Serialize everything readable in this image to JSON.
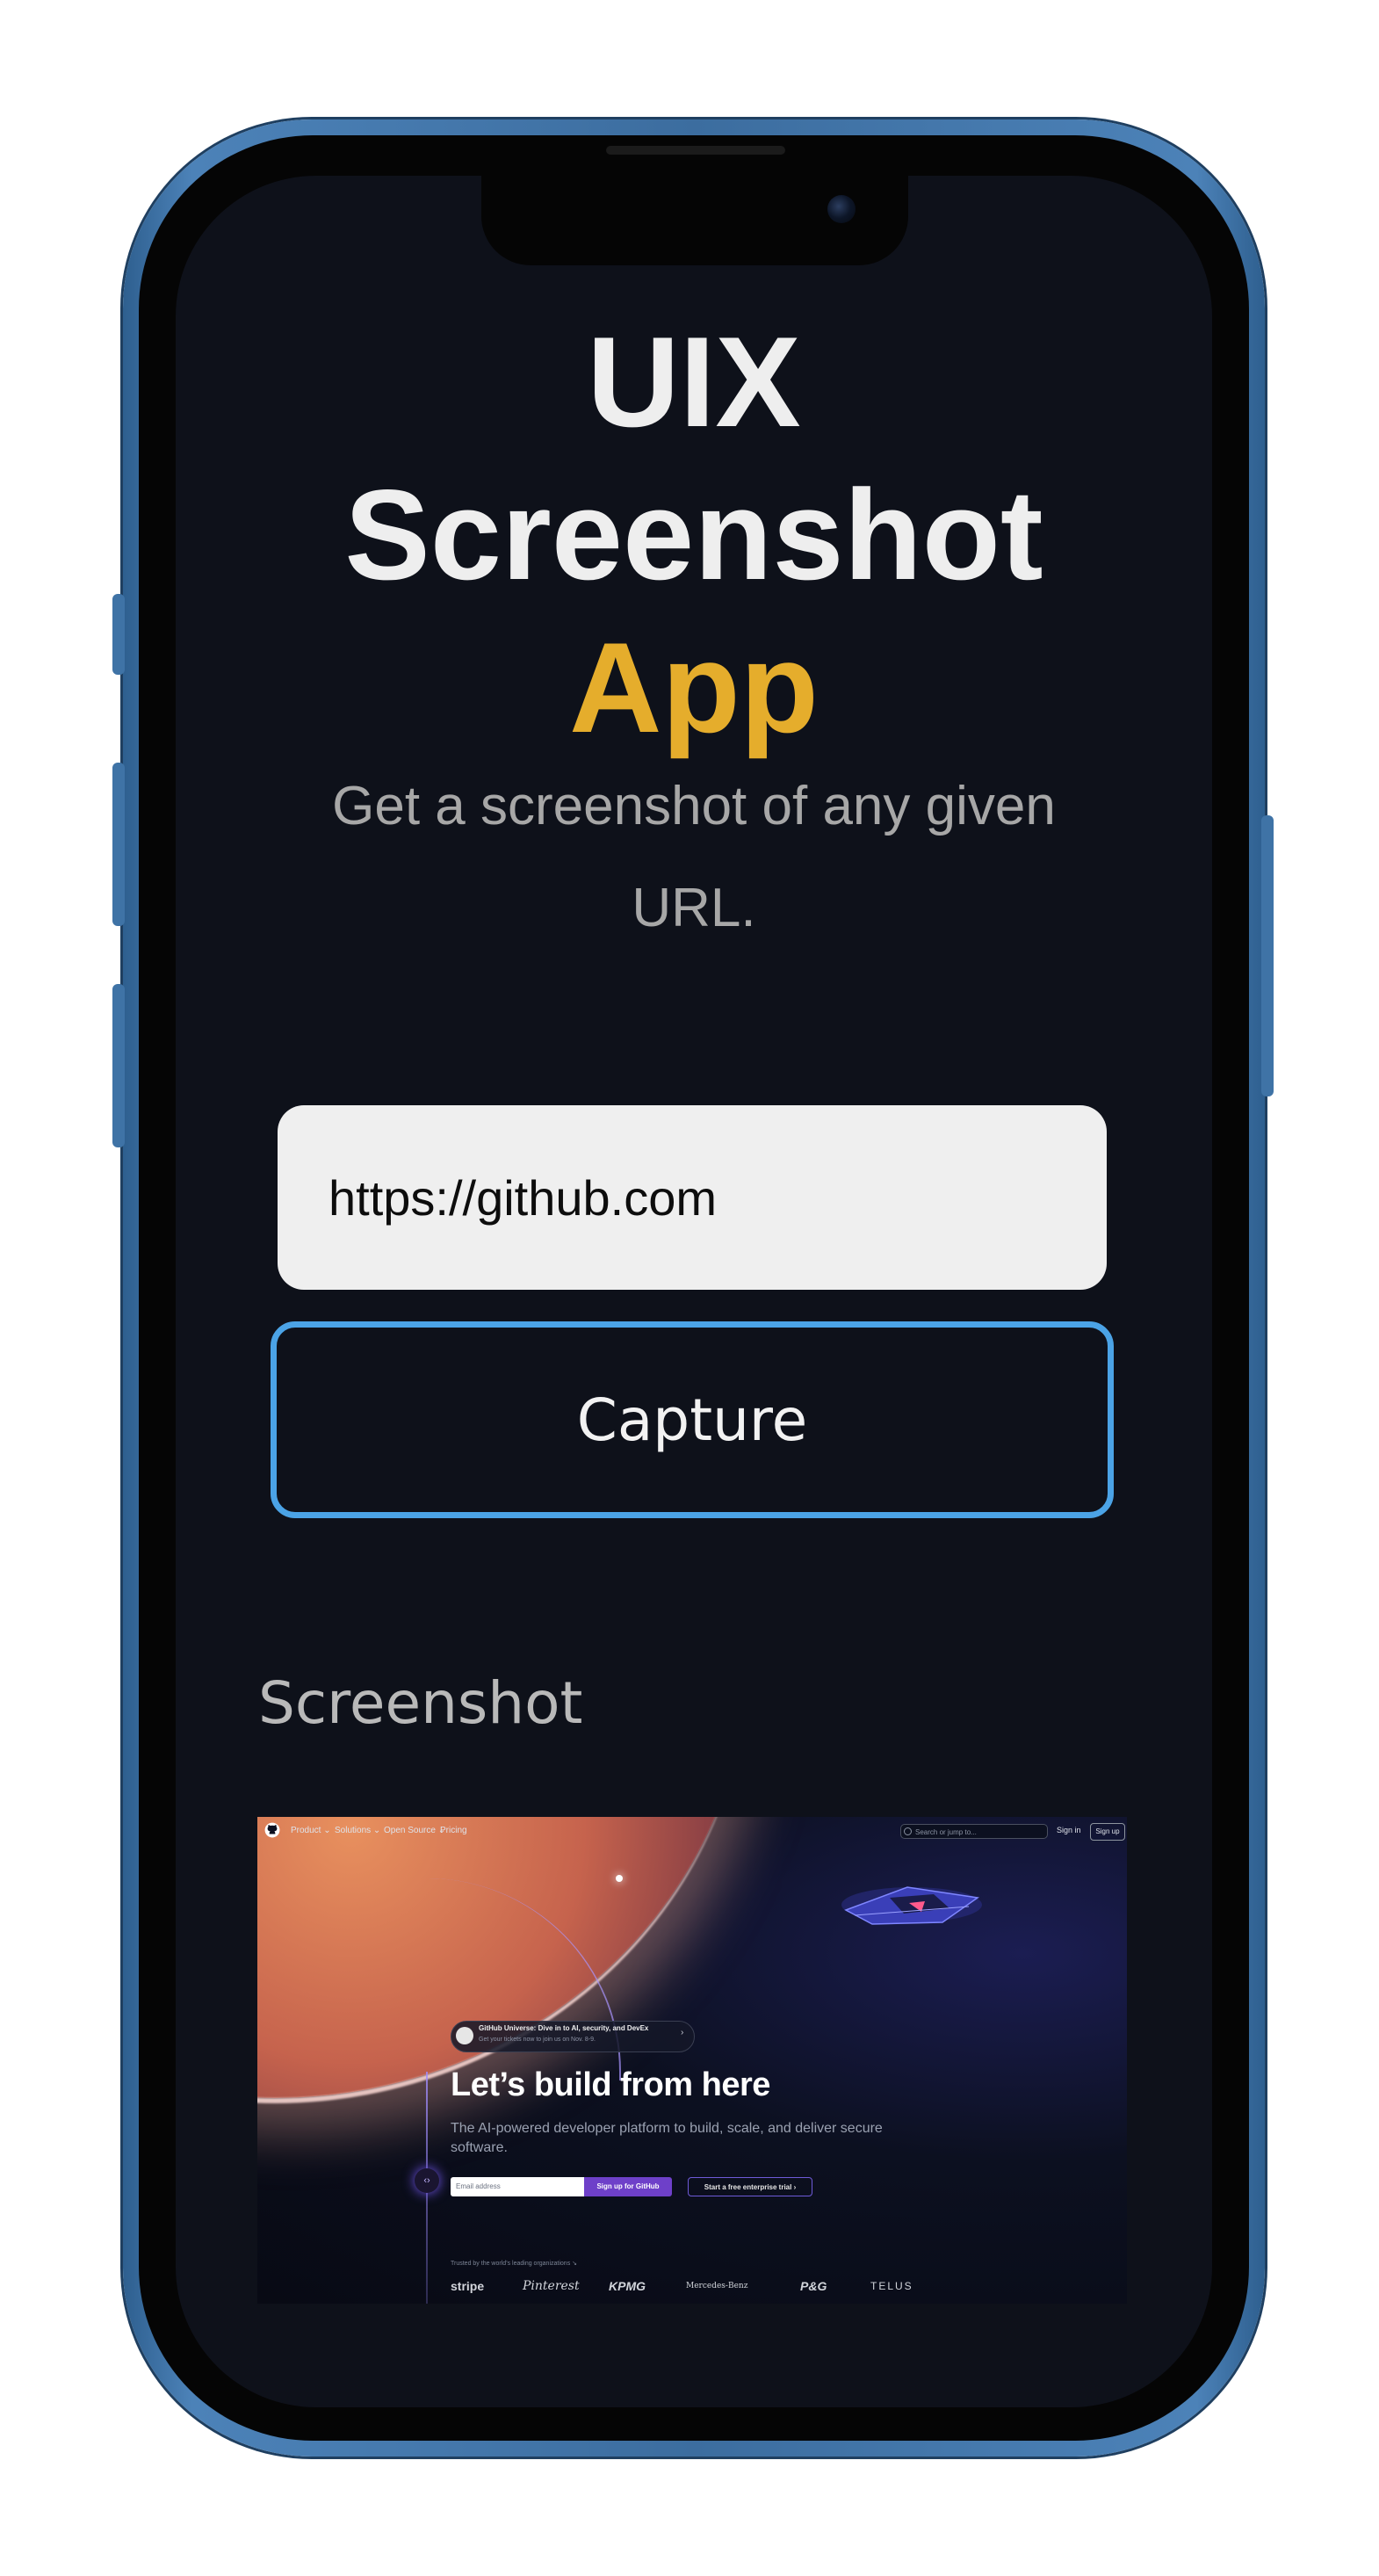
{
  "app": {
    "title_line1": "UIX",
    "title_line2": "Screenshot",
    "title_line3": "App",
    "subtitle": "Get a screenshot of any given URL.",
    "url_value": "https://github.com",
    "capture_label": "Capture",
    "section_label": "Screenshot",
    "accent_color": "#e5ad2c",
    "button_border_color": "#4ba3e6"
  },
  "preview": {
    "nav": [
      "Product ⌄",
      "Solutions ⌄",
      "Open Source ⌄",
      "Pricing"
    ],
    "search_placeholder": "Search or jump to...",
    "sign_in": "Sign in",
    "sign_up": "Sign up",
    "announcement_title": "GitHub Universe: Dive in to AI, security, and DevEx",
    "announcement_sub": "Get your tickets now to join us on Nov. 8-9.",
    "headline": "Let’s build from here",
    "lead": "The AI-powered developer platform to build, scale, and deliver secure software.",
    "email_placeholder": "Email address",
    "signup_button": "Sign up for GitHub",
    "enterprise_button": "Start a free enterprise trial ›",
    "trusted": "Trusted by the world’s leading organizations ↘",
    "logos": [
      "stripe",
      "Pinterest",
      "KPMG",
      "Mercedes-Benz",
      "P&G",
      "TELUS"
    ]
  }
}
